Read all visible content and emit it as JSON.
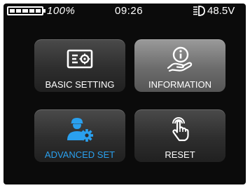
{
  "status_bar": {
    "battery_percent": "100%",
    "battery_level": 1.0,
    "time": "09:26",
    "light_icon": "headlight-icon",
    "voltage": "48.5V"
  },
  "menu": {
    "tiles": [
      {
        "label": "BASIC SETTING",
        "icon": "settings-card-icon",
        "selected": false
      },
      {
        "label": "INFORMATION",
        "icon": "info-hand-icon",
        "selected": true
      },
      {
        "label": "ADVANCED SET",
        "icon": "user-gear-icon",
        "selected": false
      },
      {
        "label": "RESET",
        "icon": "touch-hand-icon",
        "selected": false
      }
    ]
  },
  "colors": {
    "background": "#0b0b0b",
    "text": "#ffffff",
    "accent": "#2aa0ee"
  }
}
